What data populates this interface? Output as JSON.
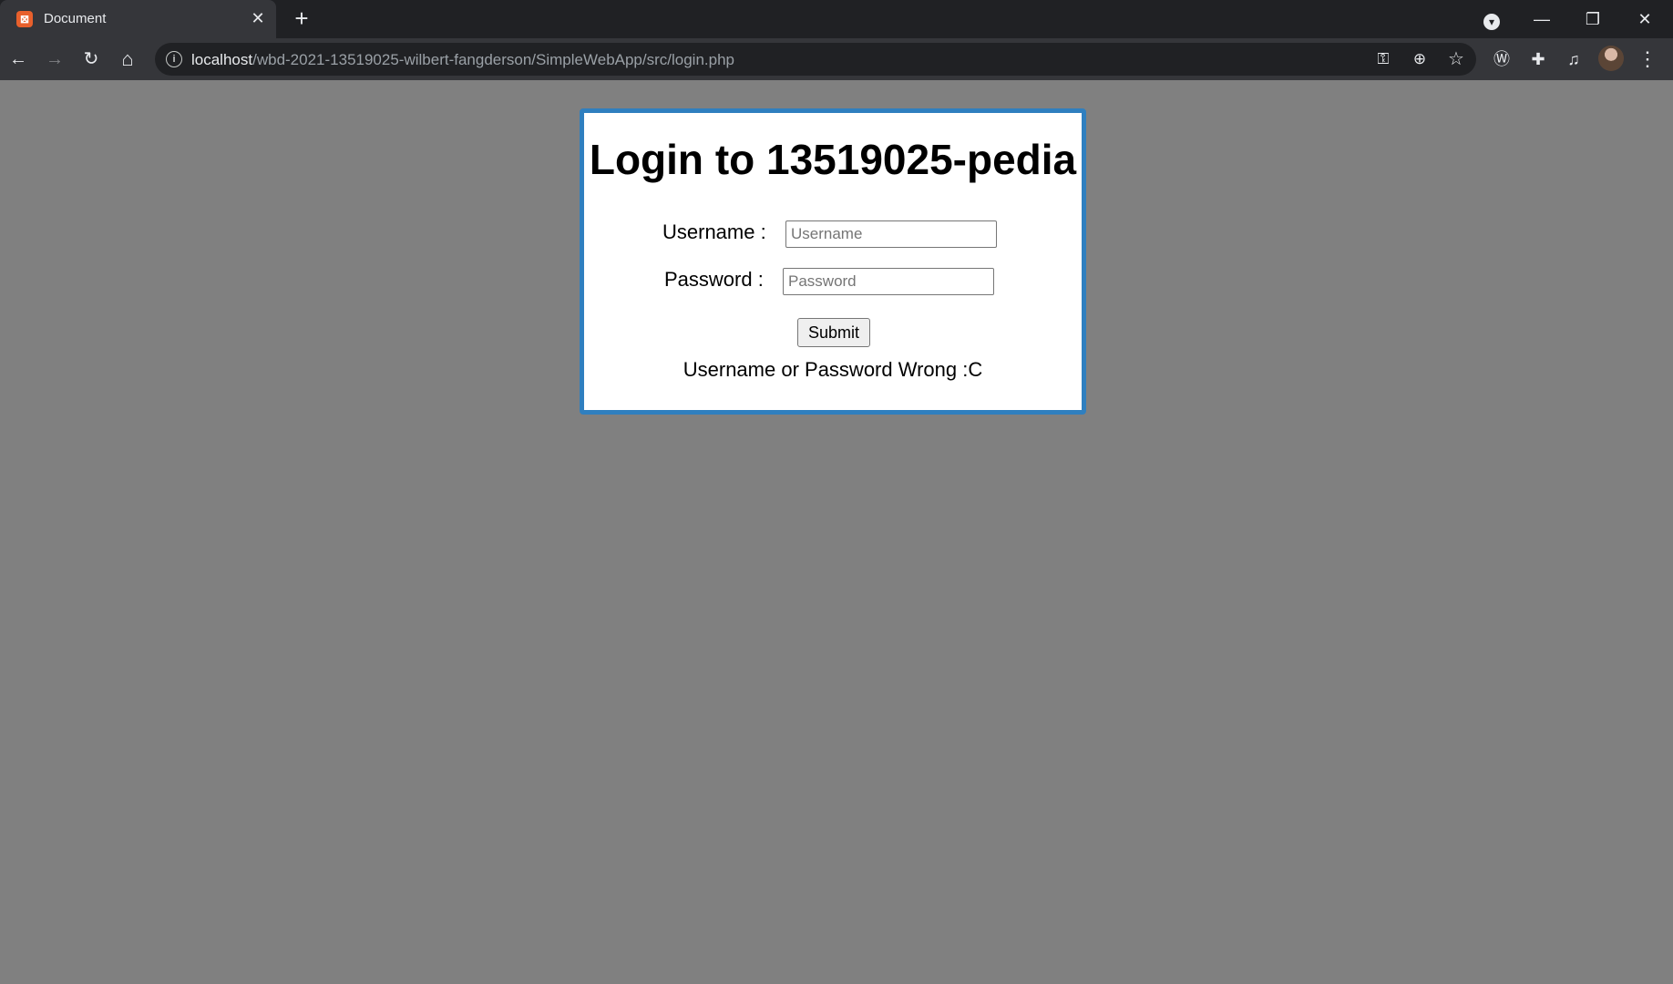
{
  "browser": {
    "tab": {
      "title": "Document",
      "favicon_icon": "xampp-icon",
      "close_glyph": "✕"
    },
    "new_tab_glyph": "+",
    "window_controls": {
      "profile_dropdown_glyph": "▾",
      "minimize_glyph": "—",
      "restore_glyph": "❐",
      "close_glyph": "✕"
    },
    "toolbar": {
      "back_glyph": "←",
      "forward_glyph": "→",
      "reload_glyph": "↻",
      "home_glyph": "⌂"
    },
    "omnibox": {
      "url_host": "localhost",
      "url_path": "/wbd-2021-13519025-wilbert-fangderson/SimpleWebApp/src/login.php",
      "key_glyph": "⚿",
      "zoom_glyph": "⊕",
      "star_glyph": "☆"
    },
    "extensions": {
      "w_ext_glyph": "Ⓦ",
      "puzzle_glyph": "✚",
      "media_glyph": "♫",
      "menu_glyph": "⋮"
    }
  },
  "login": {
    "title": "Login to 13519025-pedia",
    "username_label": "Username :",
    "username_placeholder": "Username",
    "username_value": "",
    "password_label": "Password :",
    "password_placeholder": "Password",
    "password_value": "",
    "submit_label": "Submit",
    "error_message": "Username or Password Wrong :C"
  },
  "colors": {
    "page_background": "#808080",
    "card_border": "#2f7fbf",
    "card_background": "#ffffff",
    "browser_frame": "#202124",
    "browser_toolbar": "#35363a"
  }
}
